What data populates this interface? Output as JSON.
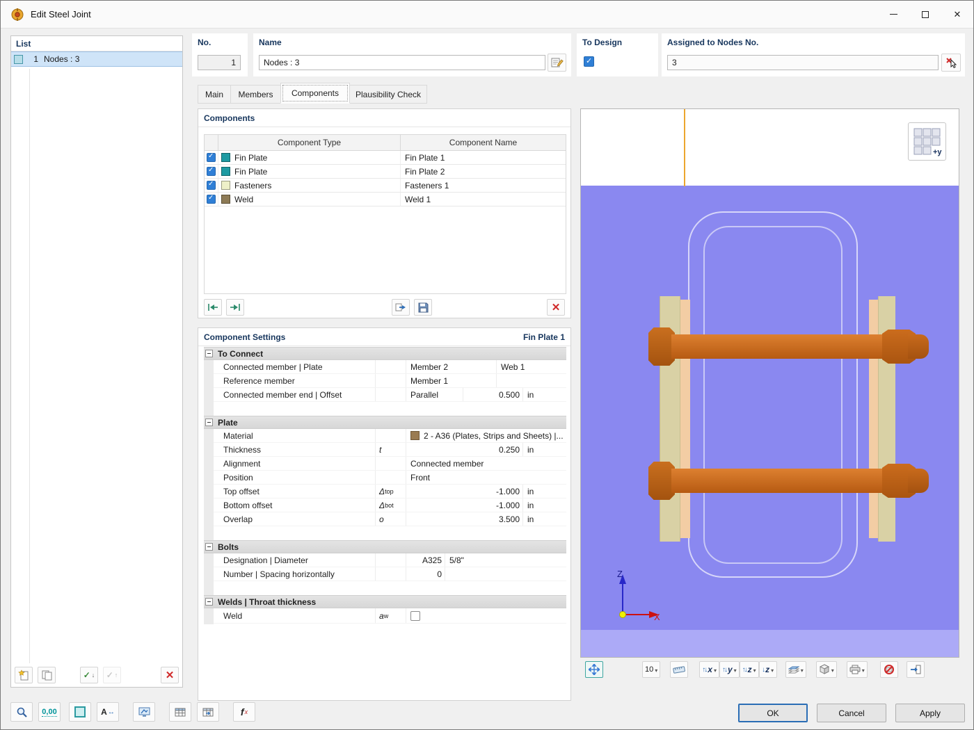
{
  "window": {
    "title": "Edit Steel Joint"
  },
  "list": {
    "header": "List",
    "item_no": "1",
    "item_label": "Nodes : 3"
  },
  "fields": {
    "no_label": "No.",
    "no_value": "1",
    "name_label": "Name",
    "name_value": "Nodes : 3",
    "to_design_label": "To Design",
    "assigned_label": "Assigned to Nodes No.",
    "assigned_value": "3"
  },
  "tabs": {
    "main": "Main",
    "members": "Members",
    "components": "Components",
    "plausibility": "Plausibility Check"
  },
  "components": {
    "title": "Components",
    "col_type": "Component Type",
    "col_name": "Component Name",
    "rows": [
      {
        "type": "Fin Plate",
        "name": "Fin Plate 1"
      },
      {
        "type": "Fin Plate",
        "name": "Fin Plate 2"
      },
      {
        "type": "Fasteners",
        "name": "Fasteners 1"
      },
      {
        "type": "Weld",
        "name": "Weld 1"
      }
    ]
  },
  "settings": {
    "title": "Component Settings",
    "subtitle": "Fin Plate 1",
    "sec_connect": "To Connect",
    "rows_connect": [
      {
        "label": "Connected member | Plate",
        "v1": "Member 2",
        "v2": "Web 1"
      },
      {
        "label": "Reference member",
        "v1": "Member 1",
        "v2": ""
      },
      {
        "label": "Connected member end | Offset",
        "v1": "Parallel",
        "num": "0.500",
        "unit": "in"
      }
    ],
    "sec_plate": "Plate",
    "rows_plate": [
      {
        "label": "Material",
        "v1": "2 - A36 (Plates, Strips and Sheets) |..."
      },
      {
        "label": "Thickness",
        "sym": "t",
        "sub": "",
        "num": "0.250",
        "unit": "in"
      },
      {
        "label": "Alignment",
        "v1": "Connected member"
      },
      {
        "label": "Position",
        "v1": "Front"
      },
      {
        "label": "Top offset",
        "sym": "Δ",
        "sub": "top",
        "num": "-1.000",
        "unit": "in"
      },
      {
        "label": "Bottom offset",
        "sym": "Δ",
        "sub": "bot",
        "num": "-1.000",
        "unit": "in"
      },
      {
        "label": "Overlap",
        "sym": "o",
        "sub": "",
        "num": "3.500",
        "unit": "in"
      }
    ],
    "sec_bolts": "Bolts",
    "rows_bolts": [
      {
        "label": "Designation | Diameter",
        "v1": "A325",
        "v2": "5/8\""
      },
      {
        "label": "Number | Spacing horizontally",
        "v1": "0",
        "v2": ""
      }
    ],
    "sec_welds": "Welds | Throat thickness",
    "rows_welds": [
      {
        "label": "Weld",
        "sym": "a",
        "sub": "w"
      }
    ]
  },
  "viewport": {
    "orientation": "+y",
    "axis_x": "X",
    "axis_z": "Z",
    "decimals": "10",
    "flip_x": "x",
    "flip_y": "y",
    "flip_z": "z",
    "reverse_z": "z"
  },
  "toolbar": {
    "decimals_label": "0,00",
    "font_label": "A",
    "formula_f": "f",
    "formula_x": "x"
  },
  "footer": {
    "ok": "OK",
    "cancel": "Cancel",
    "apply": "Apply"
  },
  "colors": {
    "accent": "#2f7fd6",
    "viewport_bg": "#8a88f0",
    "fin_plate": "#1d9aa2",
    "fasteners": "#eef0c8",
    "weld": "#8d7a55",
    "material": "#9a7b52",
    "bolt": "#c8641a"
  }
}
